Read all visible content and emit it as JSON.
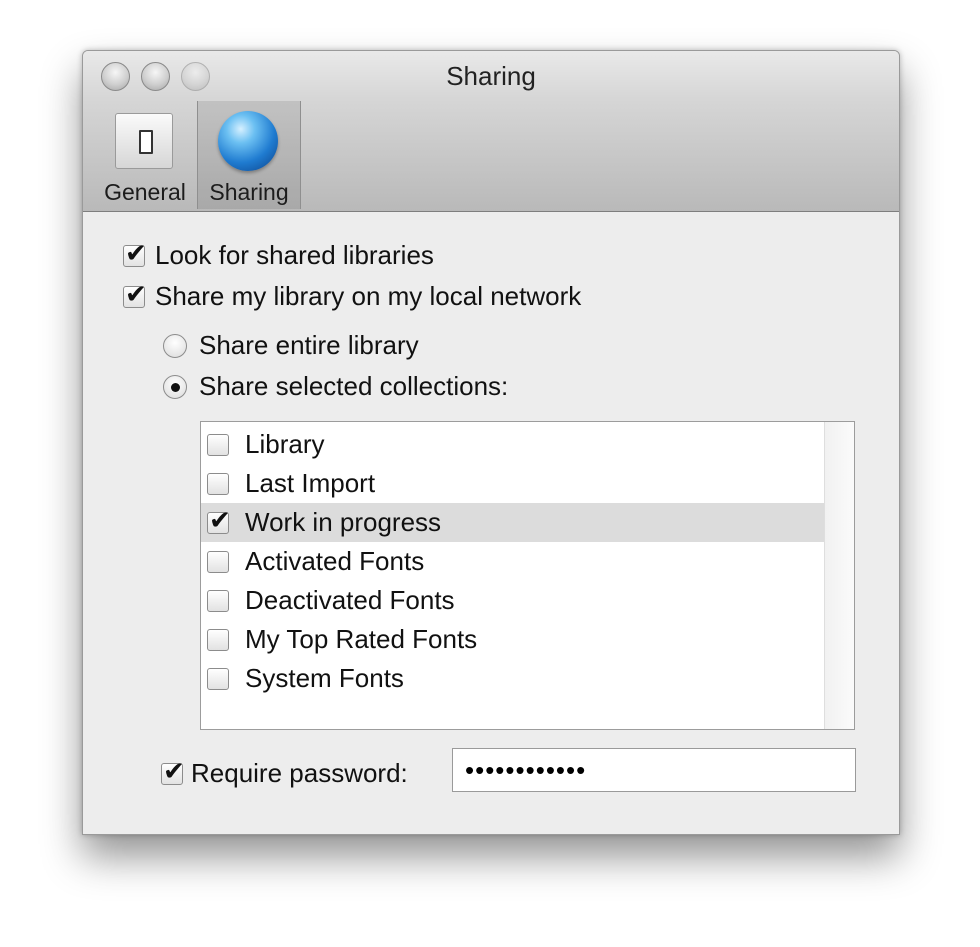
{
  "window": {
    "title": "Sharing"
  },
  "toolbar": {
    "items": [
      {
        "label": "General",
        "icon": "switch-icon",
        "selected": false
      },
      {
        "label": "Sharing",
        "icon": "globe-icon",
        "selected": true
      }
    ]
  },
  "options": {
    "look_for_shared": {
      "label": "Look for shared libraries",
      "checked": true
    },
    "share_library": {
      "label": "Share my library on my local network",
      "checked": true
    },
    "share_mode": {
      "entire": {
        "label": "Share entire library",
        "selected": false
      },
      "selected_collections": {
        "label": "Share selected collections:",
        "selected": true
      }
    }
  },
  "collections": [
    {
      "label": "Library",
      "checked": false,
      "highlighted": false
    },
    {
      "label": "Last Import",
      "checked": false,
      "highlighted": false
    },
    {
      "label": "Work in progress",
      "checked": true,
      "highlighted": true
    },
    {
      "label": "Activated Fonts",
      "checked": false,
      "highlighted": false
    },
    {
      "label": "Deactivated Fonts",
      "checked": false,
      "highlighted": false
    },
    {
      "label": "My Top Rated Fonts",
      "checked": false,
      "highlighted": false
    },
    {
      "label": "System Fonts",
      "checked": false,
      "highlighted": false
    }
  ],
  "password": {
    "label": "Require password:",
    "checked": true,
    "value": "••••••••••••"
  }
}
